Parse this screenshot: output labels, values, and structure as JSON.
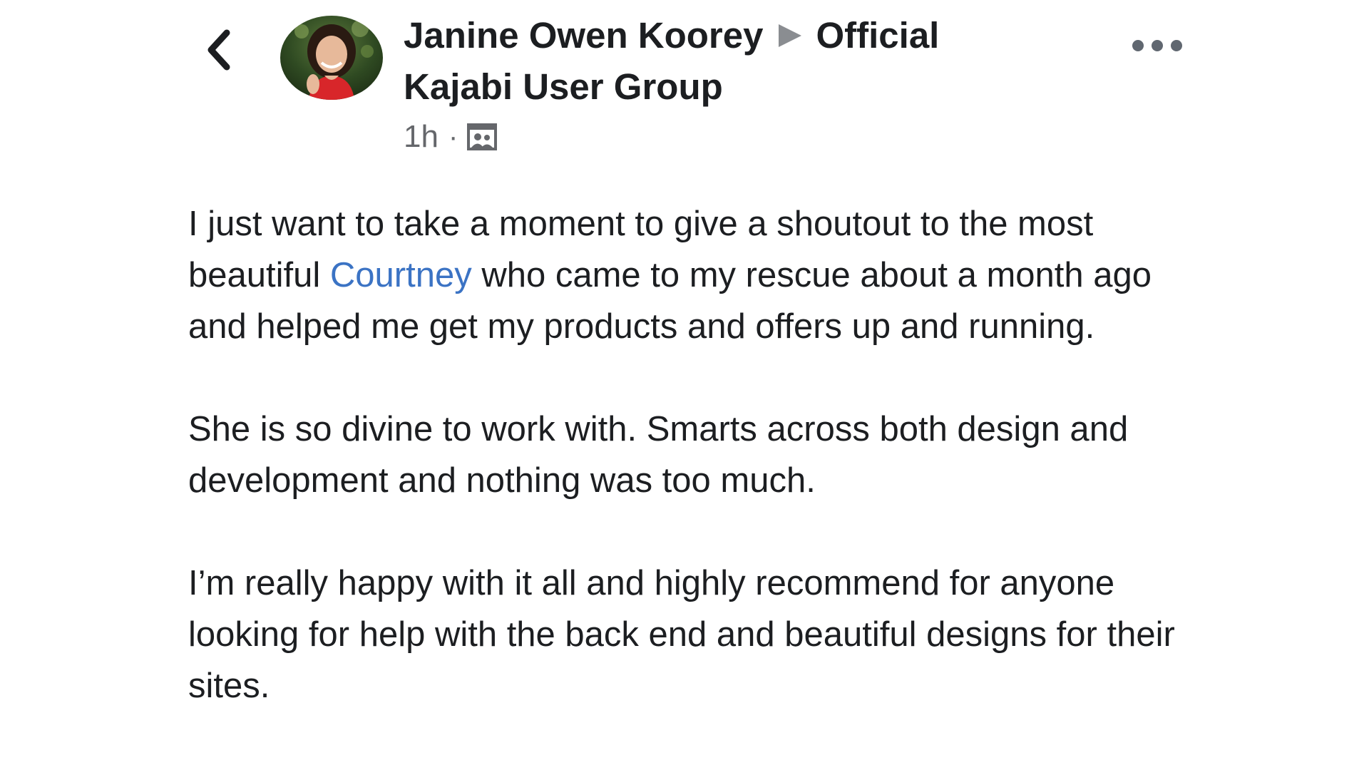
{
  "header": {
    "author_name": "Janine Owen Koorey",
    "group_name": "Official Kajabi User Group",
    "timestamp": "1h",
    "separator": "·",
    "audience_icon": "group-audience-icon",
    "back_icon": "chevron-left-icon",
    "more_icon": "more-options-icon"
  },
  "post": {
    "paragraph1_before": "I just want to take a moment to give a shoutout to the most beautiful ",
    "mention": "Courtney",
    "paragraph1_after": " who came to my rescue about a month ago and helped me get my products and offers up and running.",
    "paragraph2": "She is so divine to work with. Smarts across both design and development and nothing was too much.",
    "paragraph3": "I’m really happy with it all and highly recommend for anyone looking for help with the back end and beautiful designs for their sites."
  },
  "colors": {
    "mention": "#3b73c4",
    "text": "#1c1e21",
    "meta": "#65676b"
  }
}
